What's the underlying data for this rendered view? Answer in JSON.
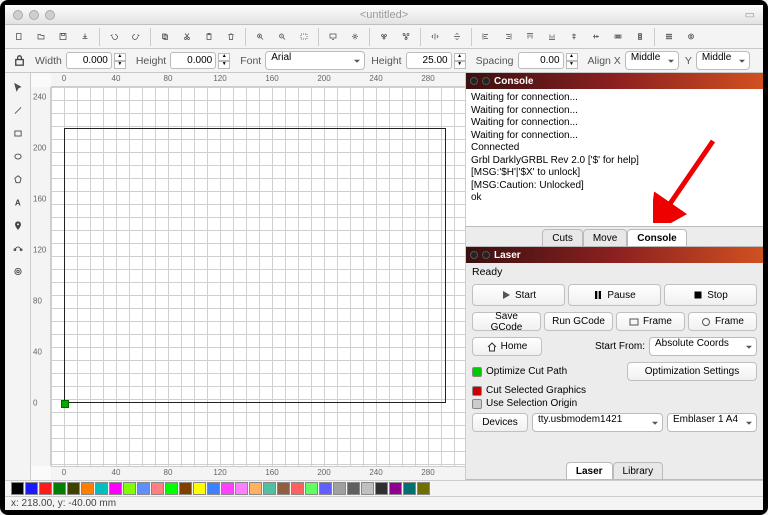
{
  "window": {
    "title": "<untitled>"
  },
  "toolbar2": {
    "width_label": "Width",
    "width": "0.000",
    "height_label": "Height",
    "height": "0.000",
    "font_label": "Font",
    "font": "Arial",
    "height2_label": "Height",
    "height2": "25.00",
    "spacing_label": "Spacing",
    "spacing": "0.00",
    "alignx_label": "Align X",
    "alignx": "Middle",
    "y_label": "Y",
    "aligny": "Middle"
  },
  "ruler_ticks": [
    "0",
    "40",
    "80",
    "120",
    "160",
    "200",
    "240",
    "280"
  ],
  "ruler_v_ticks": [
    "240",
    "200",
    "160",
    "120",
    "80",
    "40",
    "0"
  ],
  "console": {
    "title": "Console",
    "lines": [
      "Waiting for connection...",
      "Waiting for connection...",
      "Waiting for connection...",
      "Waiting for connection...",
      "Connected",
      "Grbl DarklyGRBL Rev 2.0 ['$' for help]",
      "[MSG:'$H'|'$X' to unlock]",
      "[MSG:Caution: Unlocked]",
      "ok"
    ]
  },
  "tabs_mid": {
    "cuts": "Cuts",
    "move": "Move",
    "console": "Console"
  },
  "laser": {
    "title": "Laser",
    "status": "Ready",
    "start": "Start",
    "pause": "Pause",
    "stop": "Stop",
    "save_gcode": "Save GCode",
    "run_gcode": "Run GCode",
    "frame1": "Frame",
    "frame2": "Frame",
    "home": "Home",
    "start_from_label": "Start From:",
    "start_from": "Absolute Coords",
    "opt_cut": "Optimize Cut Path",
    "opt_settings": "Optimization Settings",
    "cut_selected": "Cut Selected Graphics",
    "use_sel_origin": "Use Selection Origin",
    "devices": "Devices",
    "port": "tty.usbmodem1421",
    "machine": "Emblaser 1 A4"
  },
  "tabs_bot": {
    "laser": "Laser",
    "library": "Library"
  },
  "swatches": [
    "#000000",
    "#1a1aff",
    "#ff1a1a",
    "#008000",
    "#404000",
    "#ff8000",
    "#00bfbf",
    "#ff00ff",
    "#80ff00",
    "#5f8fff",
    "#ff8080",
    "#00ff00",
    "#804000",
    "#ffff00",
    "#4080ff",
    "#ff40ff",
    "#ff80ff",
    "#ffb060",
    "#4fc0a0",
    "#8f5f3f",
    "#ff6060",
    "#60ff60",
    "#6060ff",
    "#a0a0a0",
    "#606060",
    "#c0c0c0",
    "#303030",
    "#900090",
    "#007070",
    "#707000"
  ],
  "status": {
    "coords": "x: 218.00, y: -40.00 mm"
  }
}
